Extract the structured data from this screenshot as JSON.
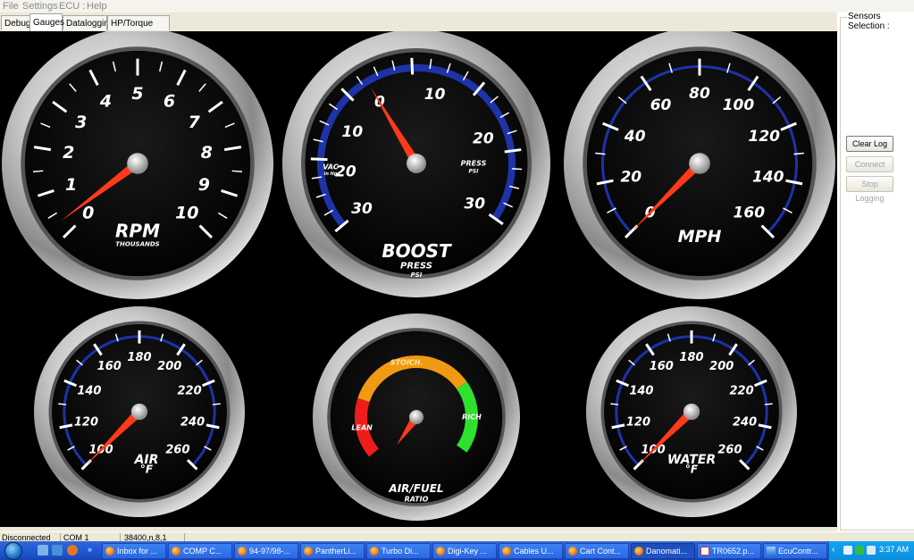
{
  "menu": [
    "File",
    "Settings",
    "ECU :",
    "Help"
  ],
  "tabs": [
    {
      "label": "Debug",
      "active": false
    },
    {
      "label": "Gauges",
      "active": true
    },
    {
      "label": "Datalogging",
      "active": false
    },
    {
      "label": "HP/Torque Trace",
      "active": false
    }
  ],
  "gauges": {
    "rpm": {
      "ticks": [
        "0",
        "1",
        "2",
        "3",
        "4",
        "5",
        "6",
        "7",
        "8",
        "9",
        "10"
      ],
      "title": "RPM",
      "subtitle": "THOUSANDS",
      "value": 0.3
    },
    "boost": {
      "vac_ticks": [
        "30",
        "20",
        "10",
        "0"
      ],
      "press_ticks": [
        "10",
        "20",
        "30"
      ],
      "title": "BOOST",
      "subtitle": "PRESS",
      "unit": "PSI",
      "vac_label": "VAC",
      "vac_unit": "in Hg",
      "press_label": "PRESS",
      "press_unit": "PSI",
      "needle": "0"
    },
    "mph": {
      "ticks": [
        "0",
        "20",
        "40",
        "60",
        "80",
        "100",
        "120",
        "140",
        "160"
      ],
      "title": "MPH",
      "value": 0
    },
    "air": {
      "ticks": [
        "100",
        "120",
        "140",
        "160",
        "180",
        "200",
        "220",
        "240",
        "260"
      ],
      "title": "AIR",
      "unit": "°F",
      "value": 100
    },
    "afr": {
      "lean": "LEAN",
      "stoich": "STOICH.",
      "rich": "RICH",
      "title": "AIR/FUEL",
      "subtitle": "RATIO"
    },
    "water": {
      "ticks": [
        "100",
        "120",
        "140",
        "160",
        "180",
        "200",
        "220",
        "240",
        "260"
      ],
      "title": "WATER",
      "unit": "°F",
      "value": 100
    }
  },
  "sensors": {
    "title": "Sensors Selection :",
    "buttons": [
      {
        "label": "Clear Log",
        "enabled": true
      },
      {
        "label": "Connect",
        "enabled": false
      },
      {
        "label": "Stop Logging",
        "enabled": false
      }
    ]
  },
  "status": {
    "connection": "Disconnected",
    "port": "COM 1",
    "settings": "38400,n,8,1"
  },
  "taskbar": {
    "items": [
      "Inbox for ...",
      "COMP C...",
      "94-97/98-...",
      "PantherLi...",
      "Turbo Di...",
      "Digi-Key ...",
      "Cables U...",
      "Cart Cont...",
      "Danomati...",
      "TR0652.p...",
      "EcuContr..."
    ],
    "active_index": 8,
    "clock": "3:37 AM"
  },
  "colors": {
    "needle": "#ff3a1a",
    "arc_blue": "#1d33a8",
    "lean": "#f01c1c",
    "stoich": "#f09a13",
    "rich": "#2fe02f"
  }
}
